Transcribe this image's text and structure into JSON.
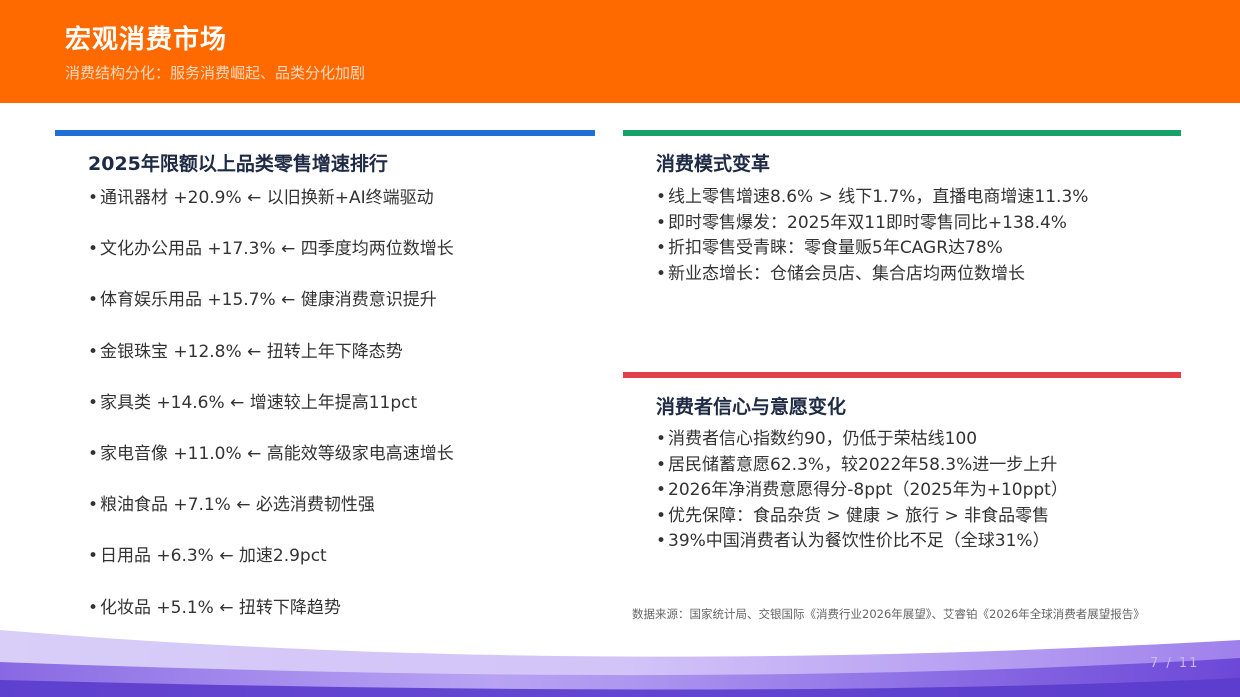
{
  "header": {
    "title": "宏观消费市场",
    "subtitle": "消费结构分化：服务消费崛起、品类分化加剧"
  },
  "colors": {
    "header_bg": "#ff6a00",
    "accent_blue": "#1f6fd6",
    "accent_green": "#16a06a",
    "accent_red": "#e0414a"
  },
  "left_section": {
    "title": "2025年限额以上品类零售增速排行",
    "items": [
      {
        "text": "通讯器材 +20.9% ← 以旧换新+AI终端驱动"
      },
      {
        "text": "文化办公用品 +17.3% ← 四季度均两位数增长"
      },
      {
        "text": "体育娱乐用品 +15.7% ← 健康消费意识提升"
      },
      {
        "text": "金银珠宝 +12.8% ← 扭转上年下降态势"
      },
      {
        "text": "家具类 +14.6% ← 增速较上年提高11pct"
      },
      {
        "text": "家电音像 +11.0% ← 高能效等级家电高速增长"
      },
      {
        "text": "粮油食品 +7.1% ← 必选消费韧性强"
      },
      {
        "text": "日用品 +6.3% ← 加速2.9pct"
      },
      {
        "text": "化妆品 +5.1% ← 扭转下降趋势"
      }
    ]
  },
  "mode_section": {
    "title": "消费模式变革",
    "items": [
      {
        "text": "线上零售增速8.6% > 线下1.7%，直播电商增速11.3%"
      },
      {
        "text": "即时零售爆发：2025年双11即时零售同比+138.4%"
      },
      {
        "text": "折扣零售受青睐：零食量贩5年CAGR达78%"
      },
      {
        "text": "新业态增长：仓储会员店、集合店均两位数增长"
      }
    ]
  },
  "confidence_section": {
    "title": "消费者信心与意愿变化",
    "items": [
      {
        "text": "消费者信心指数约90，仍低于荣枯线100"
      },
      {
        "text": "居民储蓄意愿62.3%，较2022年58.3%进一步上升"
      },
      {
        "text": "2026年净消费意愿得分-8ppt（2025年为+10ppt）"
      },
      {
        "text": "优先保障：食品杂货 > 健康 > 旅行 > 非食品零售"
      },
      {
        "text": "39%中国消费者认为餐饮性价比不足（全球31%）"
      }
    ]
  },
  "source": "数据来源：国家统计局、交银国际《消费行业2026年展望》、艾睿铂《2026年全球消费者展望报告》",
  "page_number": "7 / 11",
  "bullet": "•"
}
